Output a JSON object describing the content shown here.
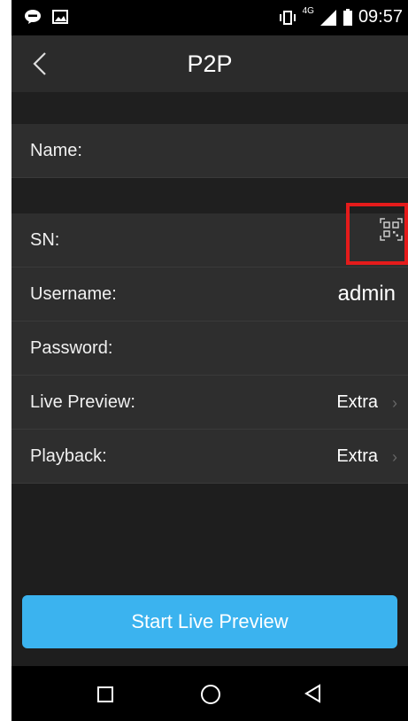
{
  "status_bar": {
    "time": "09:57",
    "network": "4G",
    "icons": [
      "line-app-icon",
      "image-icon",
      "vibrate-icon",
      "signal-icon",
      "battery-icon"
    ]
  },
  "header": {
    "title": "P2P",
    "back_icon": "back-arrow-icon"
  },
  "form": {
    "name_label": "Name:",
    "sn_label": "SN:",
    "username_label": "Username:",
    "username_value": "admin",
    "password_label": "Password:",
    "live_preview_label": "Live Preview:",
    "live_preview_value": "Extra",
    "playback_label": "Playback:",
    "playback_value": "Extra",
    "qr_icon": "qr-scan-icon"
  },
  "actions": {
    "start_live_preview": "Start Live Preview"
  },
  "nav": {
    "icons": [
      "recents-square-icon",
      "home-circle-icon",
      "back-triangle-icon"
    ]
  },
  "colors": {
    "accent": "#3bb3ef",
    "highlight": "#e51b1b",
    "background": "#1e1e1e",
    "row": "#2e2e2e"
  }
}
